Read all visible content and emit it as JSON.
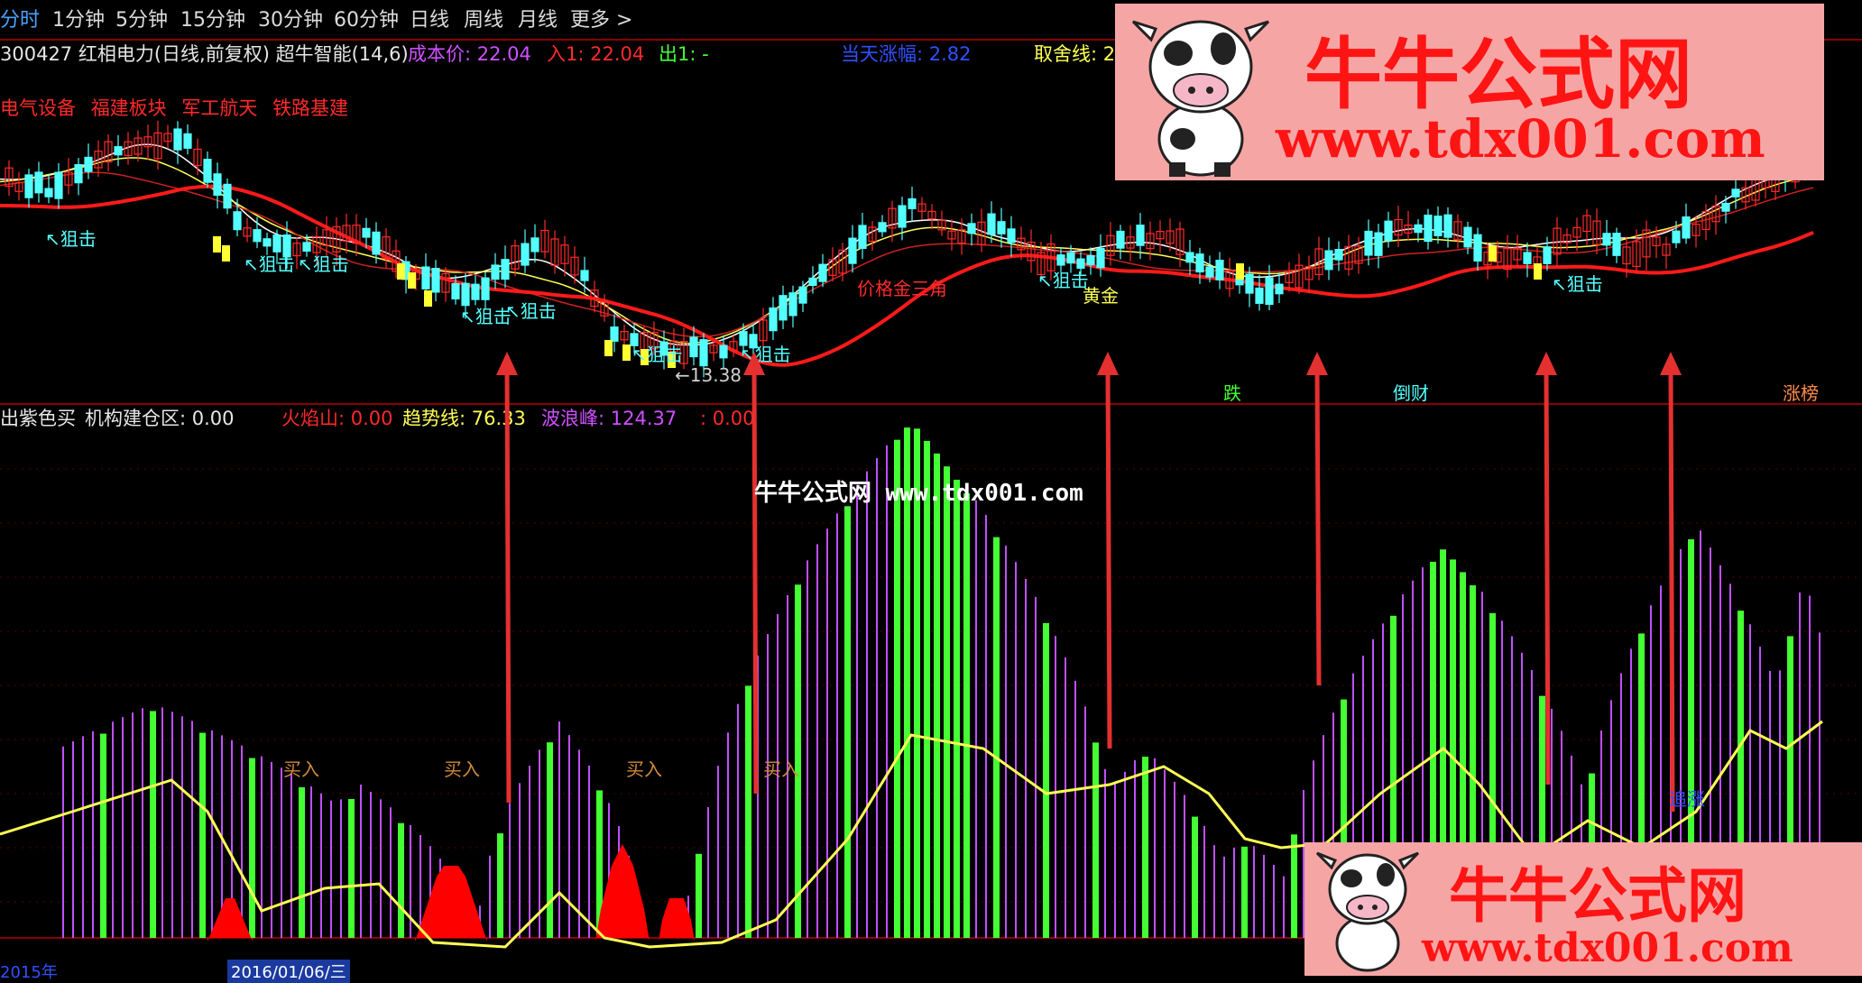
{
  "toolbar": {
    "items": [
      "分时",
      "1分钟",
      "5分钟",
      "15分钟",
      "30分钟",
      "60分钟",
      "日线",
      "周线",
      "月线",
      "更多 >"
    ]
  },
  "header": {
    "stock": "300427 红相电力(日线,前复权) 超牛智能(14,6)",
    "cost_label": "成本价: 22.04",
    "in_label": "入1: 22.04",
    "out_label": "出1: -",
    "today_label": "当天涨幅: 2.82",
    "take_label": "取舍线: 2"
  },
  "sectors": [
    "电气设备",
    "福建板块",
    "军工航天",
    "铁路基建"
  ],
  "price_chart": {
    "low_label": "13.38",
    "snipe_label": "狙击",
    "golden_cross": "黄金",
    "golden_triangle": "价格金三角",
    "tags": [
      "跌",
      "倒财",
      "涨榜"
    ]
  },
  "indicator": {
    "name": "出紫色买",
    "inst_label": "机构建仓区: 0.00",
    "fire_label": "火焰山: 0.00",
    "trend_label": "趋势线: 76.33",
    "wave_label": "波浪峰: 124.37",
    "extra_label": ": 0.00",
    "buy_label": "买入",
    "fast_label": "追涨"
  },
  "timeline": {
    "date_label": "2016/01/06/三",
    "year_label": "2015年"
  },
  "watermark": {
    "site_name": "牛牛公式网",
    "url": "www.tdx001.com",
    "overlay": "牛牛公式网 www.tdx001.com"
  },
  "colors": {
    "up": "#ff2a2a",
    "down": "#54ffff",
    "ma_red": "#ff1a1a",
    "ma_yellow": "#ffff55",
    "ma_white": "#ffffff",
    "green_bar": "#44ff33",
    "purple_bar": "#c050ff",
    "logo_bg": "#f6a5a5"
  }
}
